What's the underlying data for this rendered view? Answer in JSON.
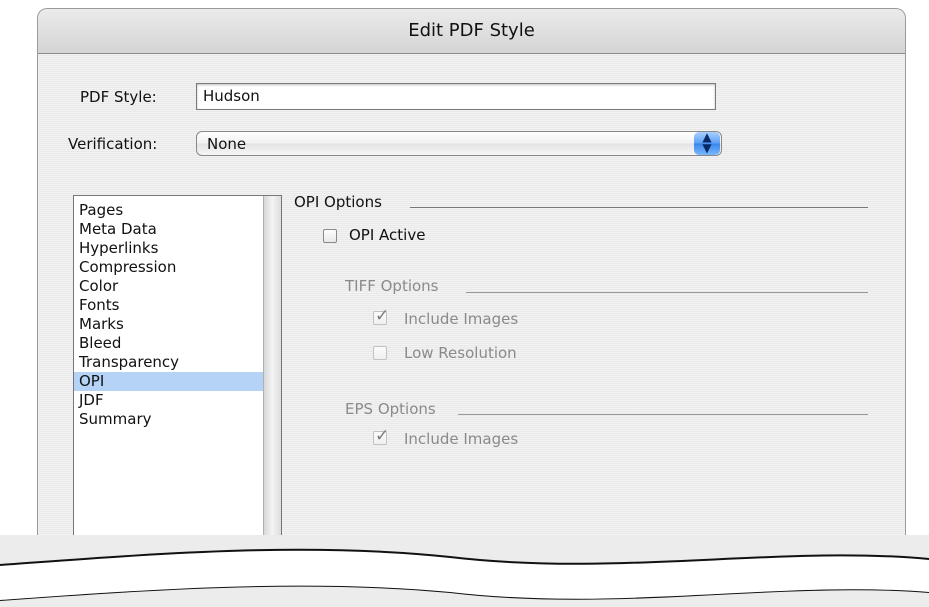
{
  "window": {
    "title": "Edit PDF Style"
  },
  "form": {
    "pdf_style_label": "PDF Style:",
    "pdf_style_value": "Hudson",
    "verification_label": "Verification:",
    "verification_value": "None"
  },
  "sidebar": {
    "items": [
      {
        "label": "Pages"
      },
      {
        "label": "Meta Data"
      },
      {
        "label": "Hyperlinks"
      },
      {
        "label": "Compression"
      },
      {
        "label": "Color"
      },
      {
        "label": "Fonts"
      },
      {
        "label": "Marks"
      },
      {
        "label": "Bleed"
      },
      {
        "label": "Transparency"
      },
      {
        "label": "OPI",
        "selected": true
      },
      {
        "label": "JDF"
      },
      {
        "label": "Summary"
      }
    ]
  },
  "opi": {
    "title": "OPI Options",
    "active_label": "OPI Active",
    "active_checked": false,
    "tiff": {
      "title": "TIFF Options",
      "include_images_label": "Include Images",
      "include_images_checked": true,
      "low_resolution_label": "Low Resolution",
      "low_resolution_checked": false
    },
    "eps": {
      "title": "EPS Options",
      "include_images_label": "Include Images",
      "include_images_checked": true
    }
  },
  "colors": {
    "selection": "#b5d3f7",
    "disabled_text": "#8a8a8a"
  }
}
